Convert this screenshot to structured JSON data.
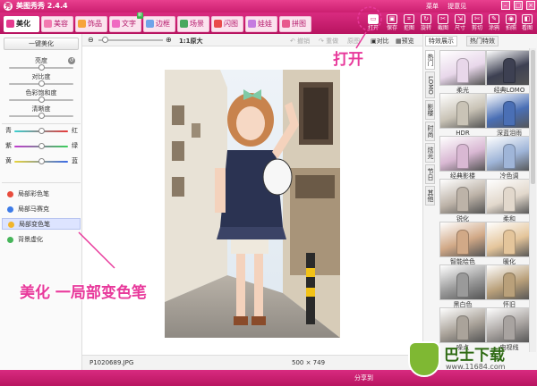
{
  "app": {
    "title": "美图秀秀 2.4.4",
    "logo_char": "秀",
    "links": [
      "菜单",
      "提意见"
    ],
    "window_buttons": [
      "–",
      "□",
      "×"
    ]
  },
  "tabs": [
    {
      "label": "美化",
      "active": true,
      "color": "#e63a8f"
    },
    {
      "label": "美容",
      "active": false,
      "color": "#f37ab0"
    },
    {
      "label": "饰品",
      "active": false,
      "color": "#f7a43b"
    },
    {
      "label": "文字",
      "active": false,
      "color": "#f06ac2",
      "badge": "新"
    },
    {
      "label": "边框",
      "active": false,
      "color": "#6fa4e8"
    },
    {
      "label": "场景",
      "active": false,
      "color": "#4aa85e"
    },
    {
      "label": "闪图",
      "active": false,
      "color": "#e94b4b"
    },
    {
      "label": "娃娃",
      "active": false,
      "color": "#c57be0"
    },
    {
      "label": "拼图",
      "active": false,
      "color": "#e8598d"
    }
  ],
  "toolbar_buttons": [
    {
      "label": "打开",
      "icon": "open-folder-icon",
      "glyph": "▭"
    },
    {
      "label": "保存",
      "icon": "save-icon",
      "glyph": "▣"
    },
    {
      "label": "拒图",
      "icon": "crop-icon",
      "glyph": "⌗"
    },
    {
      "label": "旋转",
      "icon": "rotate-icon",
      "glyph": "↻"
    },
    {
      "label": "截图",
      "icon": "screenshot-icon",
      "glyph": "✂"
    },
    {
      "label": "尺寸",
      "icon": "resize-icon",
      "glyph": "⇲"
    },
    {
      "label": "剪切",
      "icon": "cut-icon",
      "glyph": "✄"
    },
    {
      "label": "涂鸦",
      "icon": "doodle-icon",
      "glyph": "✎"
    },
    {
      "label": "拍照",
      "icon": "camera-icon",
      "glyph": "◉"
    },
    {
      "label": "看图",
      "icon": "view-image-icon",
      "glyph": "◧"
    }
  ],
  "left_panel": {
    "one_click_label": "一键美化",
    "sliders": [
      {
        "label": "亮度",
        "value": 0.5
      },
      {
        "label": "对比度",
        "value": 0.5
      },
      {
        "label": "色彩饱和度",
        "value": 0.5
      },
      {
        "label": "清晰度",
        "value": 0.5
      }
    ],
    "color_sliders": [
      {
        "left": "青",
        "right": "红",
        "value": 0.5
      },
      {
        "left": "紫",
        "right": "绿",
        "value": 0.5
      },
      {
        "left": "黄",
        "right": "蓝",
        "value": 0.5
      }
    ],
    "tools": [
      {
        "label": "局部彩色笔",
        "active": false,
        "color": "#e84c3d"
      },
      {
        "label": "局部马赛克",
        "active": false,
        "color": "#3d7be8"
      },
      {
        "label": "局部变色笔",
        "active": true,
        "color": "#f1b52c"
      },
      {
        "label": "背景虚化",
        "active": false,
        "color": "#46b55a"
      }
    ]
  },
  "canvas": {
    "zoom_label": "1:1原大",
    "actions": [
      "撤销",
      "重做",
      "原图"
    ],
    "compare_label": "对比",
    "preview_label": "预览",
    "filename": "P1020689.JPG",
    "dimensions": "500 × 749"
  },
  "right_panel": {
    "tabs": [
      "特效展示",
      "热门特效"
    ],
    "side_tabs": [
      "热门",
      "LOMO",
      "影楼",
      "时尚",
      "炫光",
      "节日",
      "其他"
    ],
    "effects": [
      {
        "label": "柔光",
        "tint": "#e8d7ea"
      },
      {
        "label": "经典LOMO",
        "tint": "#3d4052"
      },
      {
        "label": "HDR",
        "tint": "#c9c3b6"
      },
      {
        "label": "深蓝泪雨",
        "tint": "#4a6fb5"
      },
      {
        "label": "经典影楼",
        "tint": "#d9b8d3"
      },
      {
        "label": "冷色调",
        "tint": "#9fb5d8"
      },
      {
        "label": "锐化",
        "tint": "#bdb3a8"
      },
      {
        "label": "柔和",
        "tint": "#e2d8cc"
      },
      {
        "label": "智能绘色",
        "tint": "#d1a987"
      },
      {
        "label": "暖化",
        "tint": "#e4c59b"
      },
      {
        "label": "黑白色",
        "tint": "#9a9a9a"
      },
      {
        "label": "怀旧",
        "tint": "#b9a07a"
      },
      {
        "label": "噪点",
        "tint": "#aaa39a"
      },
      {
        "label": "电视线",
        "tint": "#a8a3a0"
      }
    ]
  },
  "bottom": {
    "share_label": "分享到"
  },
  "annotations": {
    "open_callout": "打开",
    "caption": "美化 一局部变色笔"
  },
  "watermark": {
    "title": "巴士下载",
    "url": "www.11684.com"
  }
}
